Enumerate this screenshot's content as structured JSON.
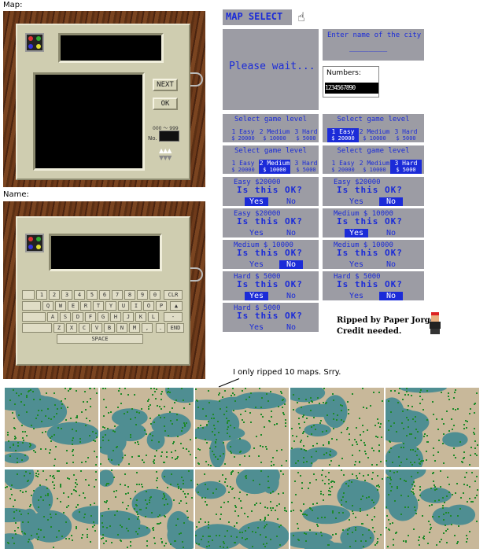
{
  "labels": {
    "map": "Map:",
    "name": "Name:",
    "note": "I only ripped 10 maps. Srry."
  },
  "map_console": {
    "next": "NEXT",
    "ok": "OK",
    "range": "000 ～ 999",
    "no_label": "No."
  },
  "keyboard": {
    "row1": [
      "1",
      "2",
      "3",
      "4",
      "5",
      "6",
      "7",
      "8",
      "9",
      "0"
    ],
    "row2": [
      "Q",
      "W",
      "E",
      "R",
      "T",
      "Y",
      "U",
      "I",
      "O",
      "P"
    ],
    "row3": [
      "A",
      "S",
      "D",
      "F",
      "G",
      "H",
      "J",
      "K",
      "L"
    ],
    "row4": [
      "Z",
      "X",
      "C",
      "V",
      "B",
      "N",
      "M",
      ","
    ],
    "clr": "CLR",
    "end": "END",
    "space": "SPACE",
    "dash": "-",
    "dot": "."
  },
  "map_select": {
    "title": "MAP SELECT",
    "please_wait": "Please wait...",
    "city_prompt": "Enter name of the city",
    "city_value": "________",
    "numbers_label": "Numbers:",
    "numbers_value": "1234567890"
  },
  "level_panels": [
    {
      "header": "Select game level",
      "selected": -1
    },
    {
      "header": "Select game level",
      "selected": 0
    },
    {
      "header": "Select game level",
      "selected": 1
    },
    {
      "header": "Select game level",
      "selected": 2
    }
  ],
  "levels": [
    {
      "name": "1 Easy",
      "money": "$ 20000"
    },
    {
      "name": "2 Medium",
      "money": "$ 10000"
    },
    {
      "name": "3 Hard",
      "money": "$ 5000"
    }
  ],
  "confirm_panels": [
    {
      "title": "Easy  $20000",
      "q": "Is this OK?",
      "yes": "Yes",
      "no": "No",
      "sel": "yes"
    },
    {
      "title": "Easy  $20000",
      "q": "Is this OK?",
      "yes": "Yes",
      "no": "No",
      "sel": "no"
    },
    {
      "title": "Easy  $20000",
      "q": "Is this OK?",
      "yes": "Yes",
      "no": "No",
      "sel": "none"
    },
    {
      "title": "Medium  $ 10000",
      "q": "Is this OK?",
      "yes": "Yes",
      "no": "No",
      "sel": "yes"
    },
    {
      "title": "Medium  $ 10000",
      "q": "Is this OK?",
      "yes": "Yes",
      "no": "No",
      "sel": "no"
    },
    {
      "title": "Medium  $ 10000",
      "q": "Is this OK?",
      "yes": "Yes",
      "no": "No",
      "sel": "none"
    },
    {
      "title": "Hard   $  5000",
      "q": "Is this OK?",
      "yes": "Yes",
      "no": "No",
      "sel": "yes"
    },
    {
      "title": "Hard   $  5000",
      "q": "Is this OK?",
      "yes": "Yes",
      "no": "No",
      "sel": "no"
    },
    {
      "title": "Hard   $  5000",
      "q": "Is this OK?",
      "yes": "Yes",
      "no": "No",
      "sel": "none"
    }
  ],
  "credits": {
    "line1": "Ripped by Paper Jorge",
    "line2": "Credit needed."
  },
  "colors": {
    "panel": "#9c9ca4",
    "text": "#1b2bd8",
    "water": "#4f8e92",
    "land": "#c8b89a",
    "trees": "#1f8a2a"
  }
}
